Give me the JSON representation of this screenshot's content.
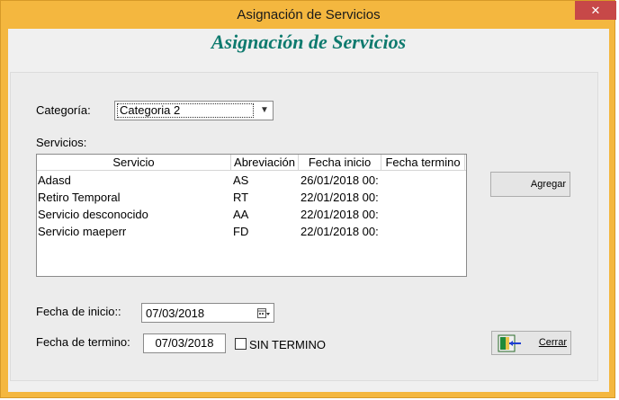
{
  "window": {
    "title": "Asignación de Servicios",
    "close_glyph": "✕"
  },
  "form": {
    "heading": "Asignación de Servicios",
    "categoria_label": "Categoría:",
    "categoria_value": "Categoria 2",
    "servicios_label": "Servicios:",
    "table": {
      "columns": [
        "Servicio",
        "Abreviación",
        "Fecha inicio",
        "Fecha termino"
      ],
      "rows": [
        [
          "Adasd",
          "AS",
          "26/01/2018 00:",
          ""
        ],
        [
          "Retiro Temporal",
          "RT",
          "22/01/2018 00:",
          ""
        ],
        [
          "Servicio desconocido",
          "AA",
          "22/01/2018 00:",
          ""
        ],
        [
          "Servicio maeperr",
          "FD",
          "22/01/2018 00:",
          ""
        ]
      ]
    },
    "agregar_label": "Agregar",
    "fecha_inicio_label": "Fecha de inicio::",
    "fecha_inicio_value": "07/03/2018",
    "fecha_termino_label": "Fecha de termino:",
    "fecha_termino_value": "07/03/2018",
    "sin_termino_label": "SIN TERMINO",
    "cerrar_label": "Cerrar",
    "cerrar_icon": "exit-door-icon"
  },
  "colors": {
    "frame": "#f4b73f",
    "heading": "#0e7a6e",
    "close": "#c74848"
  }
}
